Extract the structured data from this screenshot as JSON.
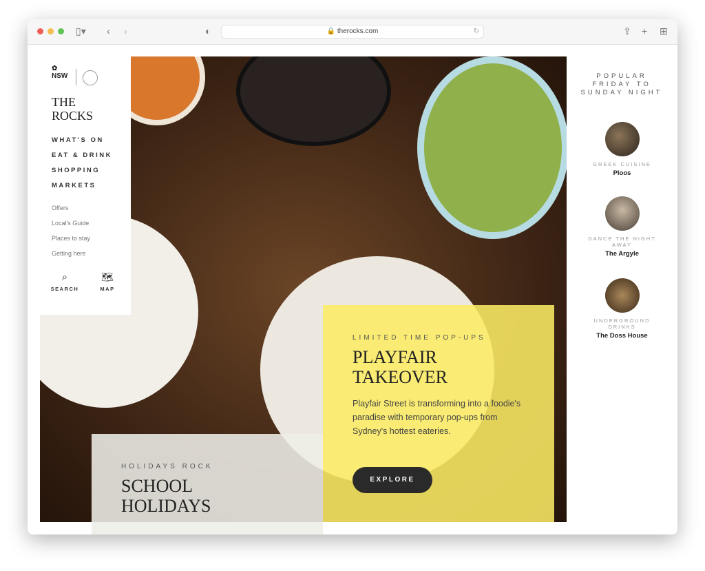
{
  "browser": {
    "url": "therocks.com",
    "traffic_lights": [
      "#ee5f57",
      "#f5bd4f",
      "#61c454"
    ]
  },
  "sidebar": {
    "logo": {
      "gov": "NSW",
      "brand": "THE ROCKS",
      "title_line1": "THE",
      "title_line2": "ROCKS"
    },
    "main_nav": [
      "WHAT'S ON",
      "EAT & DRINK",
      "SHOPPING",
      "MARKETS"
    ],
    "sub_nav": [
      "Offers",
      "Local's Guide",
      "Places to stay",
      "Getting here"
    ],
    "search_label": "SEARCH",
    "map_label": "MAP"
  },
  "popular": {
    "title": "POPULAR FRIDAY TO SUNDAY NIGHT",
    "items": [
      {
        "category": "GREEK CUISINE",
        "name": "Ploos"
      },
      {
        "category": "DANCE THE NIGHT AWAY",
        "name": "The Argyle"
      },
      {
        "category": "UNDERGROUND DRINKS",
        "name": "The Doss House"
      }
    ]
  },
  "feature": {
    "kicker": "LIMITED TIME POP-UPS",
    "title_line1": "PLAYFAIR",
    "title_line2": "TAKEOVER",
    "body": "Playfair Street is transforming into a foodie's paradise with temporary pop-ups from Sydney's hottest eateries.",
    "button": "EXPLORE",
    "color": "#faeb64"
  },
  "secondary": {
    "kicker": "HOLIDAYS ROCK",
    "title_line1": "SCHOOL",
    "title_line2": "HOLIDAYS"
  }
}
